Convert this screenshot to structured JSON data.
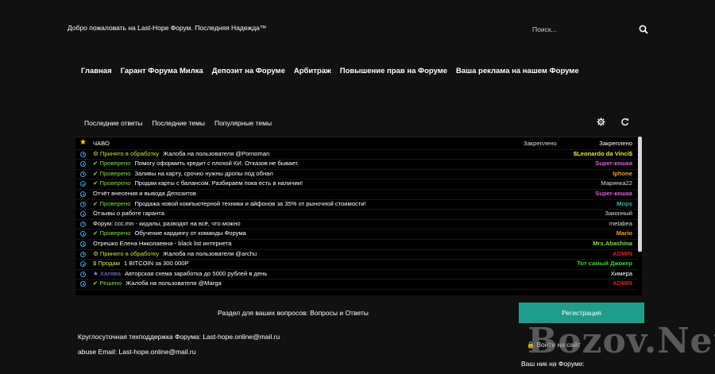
{
  "header": {
    "welcome": "Добро пожаловать на Last-Hope Форум. Последняя Надежда™",
    "search_placeholder": "Поиск..."
  },
  "nav": {
    "items": [
      "Главная",
      "Гарант Форума Милка",
      "Депозит на Форуме",
      "Арбитраж",
      "Повышение прав на Форуме",
      "Ваша реклама на нашем Форуме"
    ]
  },
  "tabs": {
    "items": [
      "Последние ответы",
      "Последние темы",
      "Популярные темы"
    ]
  },
  "topics": [
    {
      "icon": "star",
      "badge": "",
      "badge_class": "",
      "title": "ЧАВО",
      "col2": "Закреплено",
      "author": "Закреплено",
      "author_color": "#ffffff"
    },
    {
      "icon": "circle",
      "badge": "Принято в обработку",
      "badge_class": "b-proc",
      "badge_icon": "spin",
      "title": "Жалоба на пользователя @Pornoman",
      "col2": "",
      "author": "$Leonardo da Vinci$",
      "author_color": "#e7e63a"
    },
    {
      "icon": "circle",
      "badge": "Проверено",
      "badge_class": "b-ok",
      "badge_icon": "check",
      "title": "Помогу оформить кредит с плохой КИ. Отказов не бывает.",
      "col2": "",
      "author": "Super-кошка",
      "author_color": "#e55ae0"
    },
    {
      "icon": "circle",
      "badge": "Проверено",
      "badge_class": "b-ok",
      "badge_icon": "check",
      "title": "Заливы на карту, срочно нужны дропы под обнал",
      "col2": "",
      "author": "Iphone",
      "author_color": "#f0a020"
    },
    {
      "icon": "circle",
      "badge": "Проверено",
      "badge_class": "b-ok",
      "badge_icon": "check",
      "title": "Продам карты с балансом. Разбираем пока есть в наличии!",
      "col2": "",
      "author": "Маринка22",
      "author_color": "#dddddd"
    },
    {
      "icon": "circle",
      "badge": "",
      "badge_class": "",
      "title": "Отчёт внесения и вывода Депозитов",
      "col2": "",
      "author": "Super-кошка",
      "author_color": "#e55ae0"
    },
    {
      "icon": "circle",
      "badge": "Проверено",
      "badge_class": "b-ok",
      "badge_icon": "check",
      "title": "Продажа новой компьютерной техники и айфонов за 35% от рыночной стоимости!",
      "col2": "",
      "author": "Mops",
      "author_color": "#2ab6a8"
    },
    {
      "icon": "circle",
      "badge": "",
      "badge_class": "",
      "title": "Отзывы о работе гаранта",
      "col2": "",
      "author": "Законный",
      "author_color": "#dddddd"
    },
    {
      "icon": "circle",
      "badge": "",
      "badge_class": "",
      "title": "Форум: ccc.mn - кидалы, разводят на всё, что можно",
      "col2": "",
      "author": "melabea",
      "author_color": "#dddddd"
    },
    {
      "icon": "circle",
      "badge": "Проверено",
      "badge_class": "b-ok",
      "badge_icon": "check",
      "title": "Обучение кардингу от команды Форума",
      "col2": "",
      "author": "Mario",
      "author_color": "#f0a020"
    },
    {
      "icon": "circle",
      "badge": "",
      "badge_class": "",
      "title": "Отрешко Елена Николаевна - black list интернета",
      "col2": "",
      "author": "Mrs.Abashina",
      "author_color": "#7be23a"
    },
    {
      "icon": "circle",
      "badge": "Принято в обработку",
      "badge_class": "b-proc",
      "badge_icon": "spin",
      "title": "Жалоба на пользователя @archu",
      "col2": "",
      "author": "ADMIN",
      "author_color": "#e02020"
    },
    {
      "icon": "circle",
      "badge": "Продам",
      "badge_class": "b-sale",
      "badge_icon": "dollar",
      "title": "1 BITCOIN за 300 000Р",
      "col2": "",
      "author": "Тот самый Джокер",
      "author_color": "#2fd42f"
    },
    {
      "icon": "circle",
      "badge": "Халява",
      "badge_class": "b-free",
      "badge_icon": "gift",
      "title": "Авторская схема заработка до 5000 рублей в день",
      "col2": "",
      "author": "Химера",
      "author_color": "#ffffff"
    },
    {
      "icon": "circle",
      "badge": "Решено",
      "badge_class": "b-done",
      "badge_icon": "check",
      "title": "Жалоба на пользователя @Marga",
      "col2": "",
      "author": "ADMIN",
      "author_color": "#e02020"
    }
  ],
  "footer": {
    "section_text": "Раздел для ваших вопросов: Вопросы и Ответы",
    "register_label": "Регистрация",
    "support": "Круглосуточная техподдержка Форума: Last-hope.online@mail.ru",
    "abuse": "abuse Email: Last-hope.online@mail.ru",
    "login_label": "Войти на сайт",
    "nick_label": "Ваш ник на Форуме:"
  },
  "watermark": "Bozov.Net",
  "colors": {
    "accent": "#1f9c8b",
    "background": "#111111",
    "list_background": "#000000"
  }
}
